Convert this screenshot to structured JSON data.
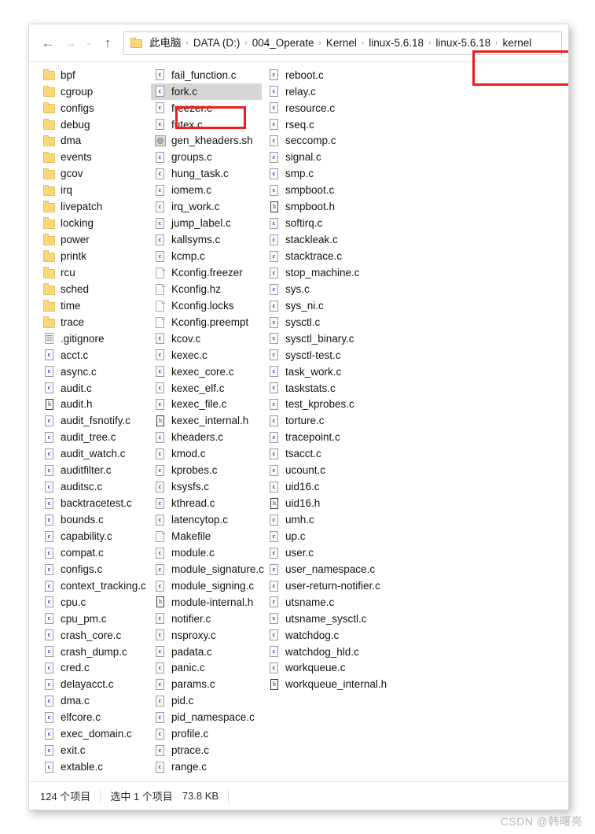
{
  "window": {
    "title": "kernel"
  },
  "nav": {
    "back_label": "←",
    "forward_label": "→",
    "recent_label": "⌄",
    "up_label": "↑",
    "back_name": "back-button",
    "forward_name": "forward-button",
    "recent_name": "recent-locations-button",
    "up_name": "up-button"
  },
  "breadcrumb": {
    "separator": "›",
    "items": [
      {
        "label": "此电脑",
        "highlighted": false
      },
      {
        "label": "DATA (D:)",
        "highlighted": false
      },
      {
        "label": "004_Operate",
        "highlighted": false
      },
      {
        "label": "Kernel",
        "highlighted": false
      },
      {
        "label": "linux-5.6.18",
        "highlighted": false
      },
      {
        "label": "linux-5.6.18",
        "highlighted": true
      },
      {
        "label": "kernel",
        "highlighted": true
      }
    ]
  },
  "annotations": {
    "box_color": "#ee1c1c",
    "breadcrumb_box_target": "linux-5.6.18 › kernel",
    "file_box_target": "fork.c"
  },
  "selection": {
    "selected_file": "fork.c"
  },
  "columns": [
    {
      "name": "column-1",
      "items": [
        {
          "name": "bpf",
          "icon": "folder"
        },
        {
          "name": "cgroup",
          "icon": "folder"
        },
        {
          "name": "configs",
          "icon": "folder"
        },
        {
          "name": "debug",
          "icon": "folder"
        },
        {
          "name": "dma",
          "icon": "folder"
        },
        {
          "name": "events",
          "icon": "folder"
        },
        {
          "name": "gcov",
          "icon": "folder"
        },
        {
          "name": "irq",
          "icon": "folder"
        },
        {
          "name": "livepatch",
          "icon": "folder"
        },
        {
          "name": "locking",
          "icon": "folder"
        },
        {
          "name": "power",
          "icon": "folder"
        },
        {
          "name": "printk",
          "icon": "folder"
        },
        {
          "name": "rcu",
          "icon": "folder"
        },
        {
          "name": "sched",
          "icon": "folder"
        },
        {
          "name": "time",
          "icon": "folder"
        },
        {
          "name": "trace",
          "icon": "folder"
        },
        {
          "name": ".gitignore",
          "icon": "doc"
        },
        {
          "name": "acct.c",
          "icon": "csrc"
        },
        {
          "name": "async.c",
          "icon": "csrc"
        },
        {
          "name": "audit.c",
          "icon": "csrc"
        },
        {
          "name": "audit.h",
          "icon": "hdr"
        },
        {
          "name": "audit_fsnotify.c",
          "icon": "csrc"
        },
        {
          "name": "audit_tree.c",
          "icon": "csrc"
        },
        {
          "name": "audit_watch.c",
          "icon": "csrc"
        },
        {
          "name": "auditfilter.c",
          "icon": "csrc"
        },
        {
          "name": "auditsc.c",
          "icon": "csrc"
        },
        {
          "name": "backtracetest.c",
          "icon": "csrc"
        },
        {
          "name": "bounds.c",
          "icon": "csrc"
        },
        {
          "name": "capability.c",
          "icon": "csrc"
        },
        {
          "name": "compat.c",
          "icon": "csrc"
        },
        {
          "name": "configs.c",
          "icon": "csrc"
        },
        {
          "name": "context_tracking.c",
          "icon": "csrc"
        },
        {
          "name": "cpu.c",
          "icon": "csrc"
        },
        {
          "name": "cpu_pm.c",
          "icon": "csrc"
        },
        {
          "name": "crash_core.c",
          "icon": "csrc"
        },
        {
          "name": "crash_dump.c",
          "icon": "csrc"
        },
        {
          "name": "cred.c",
          "icon": "csrc"
        },
        {
          "name": "delayacct.c",
          "icon": "csrc"
        },
        {
          "name": "dma.c",
          "icon": "csrc"
        },
        {
          "name": "elfcore.c",
          "icon": "csrc"
        },
        {
          "name": "exec_domain.c",
          "icon": "csrc"
        },
        {
          "name": "exit.c",
          "icon": "csrc"
        },
        {
          "name": "extable.c",
          "icon": "csrc"
        }
      ]
    },
    {
      "name": "column-2",
      "items": [
        {
          "name": "fail_function.c",
          "icon": "csrc"
        },
        {
          "name": "fork.c",
          "icon": "csrc",
          "selected": true
        },
        {
          "name": "freezer.c",
          "icon": "csrc"
        },
        {
          "name": "futex.c",
          "icon": "csrc"
        },
        {
          "name": "gen_kheaders.sh",
          "icon": "sh"
        },
        {
          "name": "groups.c",
          "icon": "csrc"
        },
        {
          "name": "hung_task.c",
          "icon": "csrc"
        },
        {
          "name": "iomem.c",
          "icon": "csrc"
        },
        {
          "name": "irq_work.c",
          "icon": "csrc"
        },
        {
          "name": "jump_label.c",
          "icon": "csrc"
        },
        {
          "name": "kallsyms.c",
          "icon": "csrc"
        },
        {
          "name": "kcmp.c",
          "icon": "csrc"
        },
        {
          "name": "Kconfig.freezer",
          "icon": "page"
        },
        {
          "name": "Kconfig.hz",
          "icon": "page"
        },
        {
          "name": "Kconfig.locks",
          "icon": "page"
        },
        {
          "name": "Kconfig.preempt",
          "icon": "page"
        },
        {
          "name": "kcov.c",
          "icon": "csrc"
        },
        {
          "name": "kexec.c",
          "icon": "csrc"
        },
        {
          "name": "kexec_core.c",
          "icon": "csrc"
        },
        {
          "name": "kexec_elf.c",
          "icon": "csrc"
        },
        {
          "name": "kexec_file.c",
          "icon": "csrc"
        },
        {
          "name": "kexec_internal.h",
          "icon": "hdr"
        },
        {
          "name": "kheaders.c",
          "icon": "csrc"
        },
        {
          "name": "kmod.c",
          "icon": "csrc"
        },
        {
          "name": "kprobes.c",
          "icon": "csrc"
        },
        {
          "name": "ksysfs.c",
          "icon": "csrc"
        },
        {
          "name": "kthread.c",
          "icon": "csrc"
        },
        {
          "name": "latencytop.c",
          "icon": "csrc"
        },
        {
          "name": "Makefile",
          "icon": "page"
        },
        {
          "name": "module.c",
          "icon": "csrc"
        },
        {
          "name": "module_signature.c",
          "icon": "csrc"
        },
        {
          "name": "module_signing.c",
          "icon": "csrc"
        },
        {
          "name": "module-internal.h",
          "icon": "hdr"
        },
        {
          "name": "notifier.c",
          "icon": "csrc"
        },
        {
          "name": "nsproxy.c",
          "icon": "csrc"
        },
        {
          "name": "padata.c",
          "icon": "csrc"
        },
        {
          "name": "panic.c",
          "icon": "csrc"
        },
        {
          "name": "params.c",
          "icon": "csrc"
        },
        {
          "name": "pid.c",
          "icon": "csrc"
        },
        {
          "name": "pid_namespace.c",
          "icon": "csrc"
        },
        {
          "name": "profile.c",
          "icon": "csrc"
        },
        {
          "name": "ptrace.c",
          "icon": "csrc"
        },
        {
          "name": "range.c",
          "icon": "csrc"
        }
      ]
    },
    {
      "name": "column-3",
      "items": [
        {
          "name": "reboot.c",
          "icon": "csrc"
        },
        {
          "name": "relay.c",
          "icon": "csrc"
        },
        {
          "name": "resource.c",
          "icon": "csrc"
        },
        {
          "name": "rseq.c",
          "icon": "csrc"
        },
        {
          "name": "seccomp.c",
          "icon": "csrc"
        },
        {
          "name": "signal.c",
          "icon": "csrc"
        },
        {
          "name": "smp.c",
          "icon": "csrc"
        },
        {
          "name": "smpboot.c",
          "icon": "csrc"
        },
        {
          "name": "smpboot.h",
          "icon": "hdr"
        },
        {
          "name": "softirq.c",
          "icon": "csrc"
        },
        {
          "name": "stackleak.c",
          "icon": "csrc"
        },
        {
          "name": "stacktrace.c",
          "icon": "csrc"
        },
        {
          "name": "stop_machine.c",
          "icon": "csrc"
        },
        {
          "name": "sys.c",
          "icon": "csrc"
        },
        {
          "name": "sys_ni.c",
          "icon": "csrc"
        },
        {
          "name": "sysctl.c",
          "icon": "csrc"
        },
        {
          "name": "sysctl_binary.c",
          "icon": "csrc"
        },
        {
          "name": "sysctl-test.c",
          "icon": "csrc"
        },
        {
          "name": "task_work.c",
          "icon": "csrc"
        },
        {
          "name": "taskstats.c",
          "icon": "csrc"
        },
        {
          "name": "test_kprobes.c",
          "icon": "csrc"
        },
        {
          "name": "torture.c",
          "icon": "csrc"
        },
        {
          "name": "tracepoint.c",
          "icon": "csrc"
        },
        {
          "name": "tsacct.c",
          "icon": "csrc"
        },
        {
          "name": "ucount.c",
          "icon": "csrc"
        },
        {
          "name": "uid16.c",
          "icon": "csrc"
        },
        {
          "name": "uid16.h",
          "icon": "hdr"
        },
        {
          "name": "umh.c",
          "icon": "csrc"
        },
        {
          "name": "up.c",
          "icon": "csrc"
        },
        {
          "name": "user.c",
          "icon": "csrc"
        },
        {
          "name": "user_namespace.c",
          "icon": "csrc"
        },
        {
          "name": "user-return-notifier.c",
          "icon": "csrc"
        },
        {
          "name": "utsname.c",
          "icon": "csrc"
        },
        {
          "name": "utsname_sysctl.c",
          "icon": "csrc"
        },
        {
          "name": "watchdog.c",
          "icon": "csrc"
        },
        {
          "name": "watchdog_hld.c",
          "icon": "csrc"
        },
        {
          "name": "workqueue.c",
          "icon": "csrc"
        },
        {
          "name": "workqueue_internal.h",
          "icon": "hdr"
        }
      ]
    }
  ],
  "statusbar": {
    "item_count": "124 个项目",
    "selection_info": "选中 1 个项目",
    "selection_size": "73.8 KB"
  },
  "watermark": {
    "text": "CSDN @韩曙亮"
  }
}
